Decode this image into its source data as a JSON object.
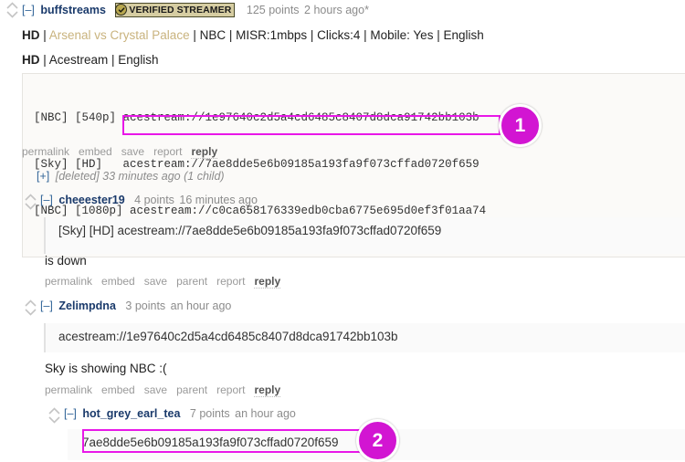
{
  "comments": [
    {
      "id": "root",
      "collapse": "[–]",
      "author": "buffstreams",
      "badge": "VERIFIED STREAMER",
      "score": "125 points",
      "time": "2 hours ago*",
      "edited_mark": "",
      "body_line_1_prefix": "HD",
      "body_line_1_sep1": " | ",
      "body_line_1_link": "Arsenal vs Crystal Palace",
      "body_line_1_rest": " | NBC | MISR:1mbps | Clicks:4 | Mobile: Yes | English",
      "body_line_2_prefix": "HD",
      "body_line_2_rest": " | Acestream | English",
      "code_lines": [
        "[NBC] [540p] acestream://1e97640c2d5a4cd6485c8407d8dca91742bb103b",
        "[Sky] [HD]   acestream://7ae8dde5e6b09185a193fa9f073cffad0720f659",
        "[NBC] [1080p] acestream://c0ca658176339edb0cba6775e695d0ef3f01aa74"
      ],
      "actions": [
        "permalink",
        "embed",
        "save",
        "report"
      ],
      "reply": "reply"
    },
    {
      "id": "deleted",
      "expand": "[+]",
      "text": "[deleted] 33 minutes ago (1 child)"
    },
    {
      "id": "cheeester19",
      "collapse": "[–]",
      "author": "cheeester19",
      "score": "4 points",
      "time": "16 minutes ago",
      "quote": "[Sky] [HD] acestream://7ae8dde5e6b09185a193fa9f073cffad0720f659",
      "body": "is down",
      "actions": [
        "permalink",
        "embed",
        "save",
        "parent",
        "report"
      ],
      "reply": "reply"
    },
    {
      "id": "zelimpdna",
      "collapse": "[–]",
      "author": "Zelimpdna",
      "score": "3 points",
      "time": "an hour ago",
      "quote": "acestream://1e97640c2d5a4cd6485c8407d8dca91742bb103b",
      "body": "Sky is showing NBC :(",
      "actions": [
        "permalink",
        "embed",
        "save",
        "parent",
        "report"
      ],
      "reply": "reply"
    },
    {
      "id": "hot_grey_earl_tea",
      "collapse": "[–]",
      "author": "hot_grey_earl_tea",
      "score": "7 points",
      "time": "an hour ago",
      "quote": "7ae8dde5e6b09185a193fa9f073cffad0720f659"
    }
  ],
  "annotations": {
    "badge_1": "1",
    "badge_2": "2",
    "highlight_color": "#e817e8",
    "badge_color": "#d215d2"
  },
  "icons": {
    "upvote": "upvote-chevron-icon",
    "downvote": "downvote-chevron-icon",
    "verified": "verified-check-icon"
  }
}
